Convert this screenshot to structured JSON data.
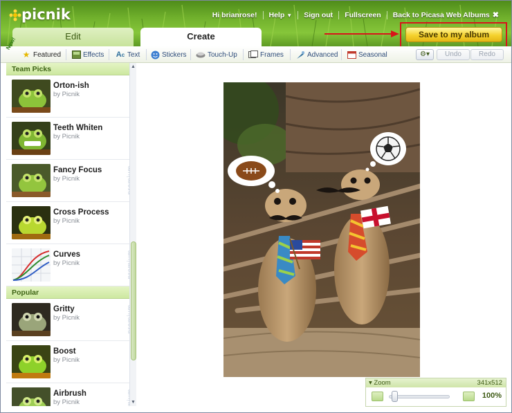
{
  "app": {
    "logo": "picnik"
  },
  "topnav": {
    "greeting": "Hi brianrose!",
    "help": "Help",
    "sign_out": "Sign out",
    "fullscreen": "Fullscreen",
    "back": "Back to Picasa Web Albums"
  },
  "tabs": {
    "edit": "Edit",
    "create": "Create"
  },
  "save_button": "Save to my album",
  "toolbar": {
    "new_badge": "New!",
    "items": [
      {
        "label": "Featured",
        "icon": "star-icon"
      },
      {
        "label": "Effects",
        "icon": "effects-icon"
      },
      {
        "label": "Text",
        "icon": "text-icon"
      },
      {
        "label": "Stickers",
        "icon": "stickers-icon"
      },
      {
        "label": "Touch-Up",
        "icon": "touchup-icon"
      },
      {
        "label": "Frames",
        "icon": "frames-icon"
      },
      {
        "label": "Advanced",
        "icon": "advanced-icon"
      },
      {
        "label": "Seasonal",
        "icon": "seasonal-icon"
      }
    ],
    "undo": "Undo",
    "redo": "Redo"
  },
  "sidebar": {
    "sections": [
      {
        "title": "Team Picks",
        "effects": [
          {
            "name": "Orton-ish",
            "by": "by Picnik",
            "premium": ""
          },
          {
            "name": "Teeth Whiten",
            "by": "by Picnik",
            "premium": ""
          },
          {
            "name": "Fancy Focus",
            "by": "by Picnik",
            "premium": "premium"
          },
          {
            "name": "Cross Process",
            "by": "by Picnik",
            "premium": ""
          },
          {
            "name": "Curves",
            "by": "by Picnik",
            "premium": "premium"
          }
        ]
      },
      {
        "title": "Popular",
        "effects": [
          {
            "name": "Gritty",
            "by": "by Picnik",
            "premium": "premium"
          },
          {
            "name": "Boost",
            "by": "by Picnik",
            "premium": ""
          },
          {
            "name": "Airbrush",
            "by": "by Picnik",
            "premium": "premium"
          }
        ]
      }
    ]
  },
  "zoom": {
    "label": "Zoom",
    "dimensions": "341x512",
    "percent": "100%",
    "level": 0.05
  },
  "colors": {
    "accent": "#f5d22e",
    "highlight": "#d8141a",
    "green": "#6eae2b"
  }
}
